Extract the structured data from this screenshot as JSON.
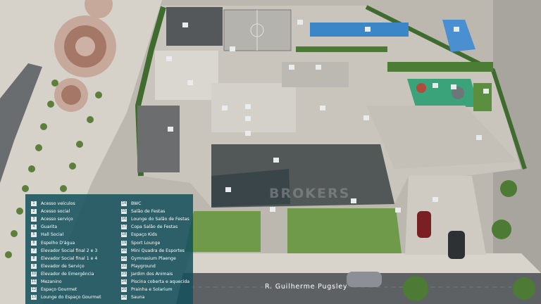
{
  "legend": {
    "items": [
      {
        "n": "1",
        "label": "Acesso veículos"
      },
      {
        "n": "2",
        "label": "Acesso social"
      },
      {
        "n": "3",
        "label": "Acesso serviço"
      },
      {
        "n": "4",
        "label": "Guarita"
      },
      {
        "n": "5",
        "label": "Hall Social"
      },
      {
        "n": "6",
        "label": "Espelho D'água"
      },
      {
        "n": "7",
        "label": "Elevador Social final 2 e 3"
      },
      {
        "n": "8",
        "label": "Elevador Social final 1 e 4"
      },
      {
        "n": "9",
        "label": "Elevador de Serviço"
      },
      {
        "n": "10",
        "label": "Elevador de Emergência"
      },
      {
        "n": "11",
        "label": "Mezanino"
      },
      {
        "n": "12",
        "label": "Espaço Gourmet"
      },
      {
        "n": "13",
        "label": "Lounge do Espaço Gourmet"
      },
      {
        "n": "14",
        "label": "BWC"
      },
      {
        "n": "15",
        "label": "Salão de Festas"
      },
      {
        "n": "16",
        "label": "Lounge do Salão de Festas"
      },
      {
        "n": "17",
        "label": "Copa Salão de Festas"
      },
      {
        "n": "18",
        "label": "Espaço Kids"
      },
      {
        "n": "19",
        "label": "Sport Lounge"
      },
      {
        "n": "20",
        "label": "Mini Quadra de Esportes"
      },
      {
        "n": "21",
        "label": "Gymnasium Plaenge"
      },
      {
        "n": "22",
        "label": "Playground"
      },
      {
        "n": "23",
        "label": "Jardim dos Animais"
      },
      {
        "n": "24",
        "label": "Piscina coberta e aquecida"
      },
      {
        "n": "25",
        "label": "Prainha e Solarium"
      },
      {
        "n": "26",
        "label": "Sauna"
      }
    ]
  },
  "street": {
    "name": "R. Guilherme Pugsley"
  },
  "watermark": {
    "text": "BROKERS"
  },
  "markers": [
    "1",
    "2",
    "3",
    "4",
    "5",
    "6",
    "7",
    "8",
    "9",
    "10",
    "11",
    "12",
    "13",
    "14",
    "15",
    "16",
    "17",
    "18",
    "19",
    "20",
    "21",
    "22",
    "23",
    "24",
    "25",
    "26"
  ],
  "colors": {
    "legend_bg": "#14505c",
    "grass": "#6f9a4a",
    "hedge": "#3f6b2e",
    "pool": "#3b86c6",
    "floor": "#c8c4bb",
    "road": "#5f6366",
    "sidewalk": "#d8d4cc"
  }
}
